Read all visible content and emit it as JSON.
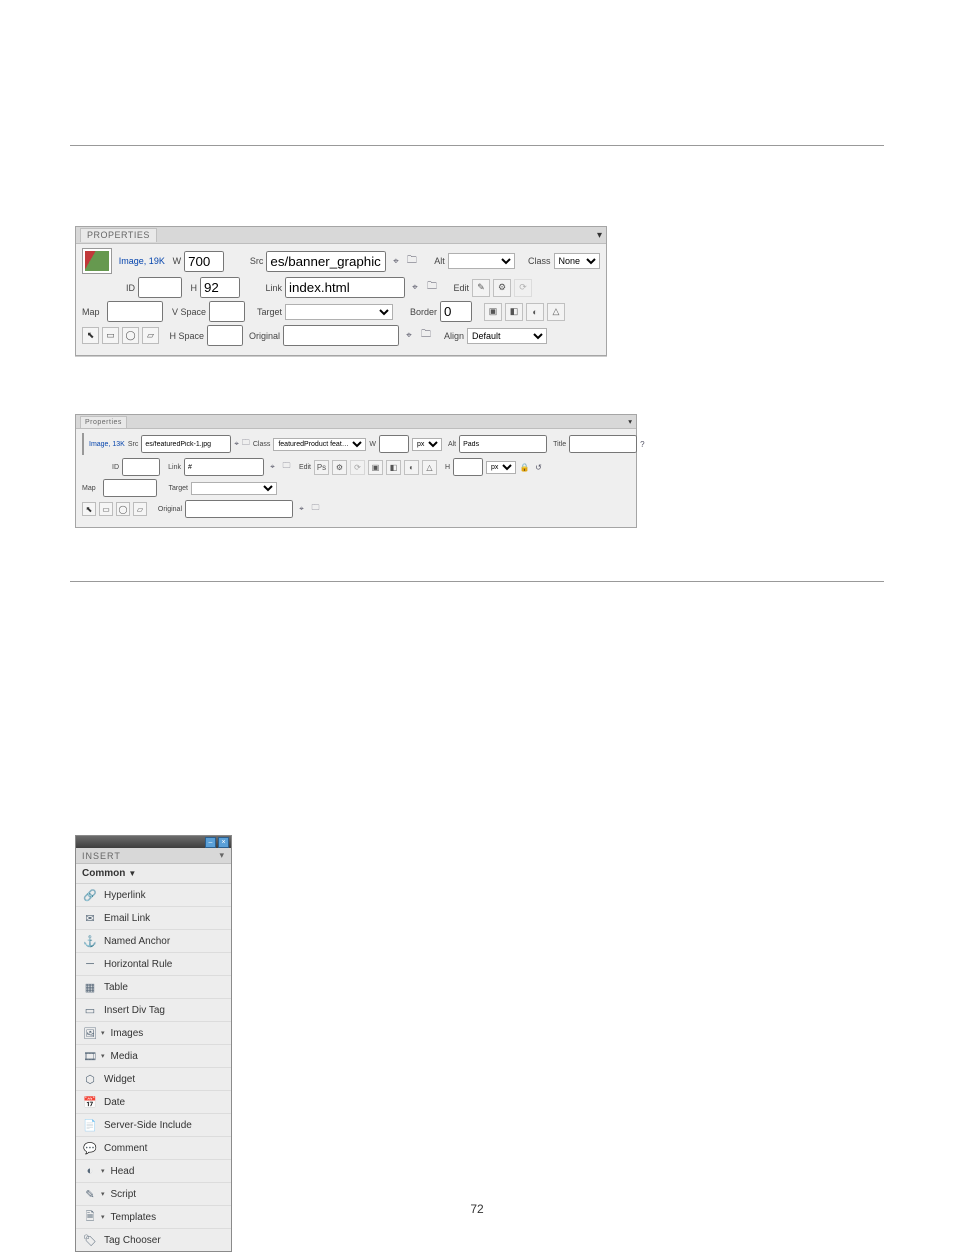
{
  "page_number": "72",
  "properties1": {
    "tab_label": "PROPERTIES",
    "image_label": "Image, 19K",
    "id_label": "ID",
    "id_value": "",
    "w_label": "W",
    "w_value": "700",
    "h_label": "H",
    "h_value": "92",
    "src_label": "Src",
    "src_value": "es/banner_graphic.jpg",
    "link_label": "Link",
    "link_value": "index.html",
    "alt_label": "Alt",
    "alt_value": "",
    "class_label": "Class",
    "class_value": "None",
    "edit_label": "Edit",
    "map_label": "Map",
    "map_value": "",
    "vspace_label": "V Space",
    "vspace_value": "",
    "hspace_label": "H Space",
    "hspace_value": "",
    "target_label": "Target",
    "target_value": "",
    "original_label": "Original",
    "original_value": "",
    "border_label": "Border",
    "border_value": "0",
    "align_label": "Align",
    "align_value": "Default"
  },
  "properties2": {
    "tab_label": "Properties",
    "image_label": "Image, 13K",
    "id_label": "ID",
    "id_value": "",
    "src_label": "Src",
    "src_value": "es/featuredPick-1.jpg",
    "link_label": "Link",
    "link_value": "#",
    "class_label": "Class",
    "class_value": "featuredProduct feat…",
    "alt_label": "Alt",
    "alt_value": "Pads",
    "title_label": "Title",
    "title_value": "",
    "edit_label": "Edit",
    "w_label": "W",
    "h_label": "H",
    "px_label": "px",
    "map_label": "Map",
    "map_value": "",
    "target_label": "Target",
    "target_value": "",
    "original_label": "Original",
    "original_value": ""
  },
  "insert": {
    "tab_label": "INSERT",
    "category": "Common",
    "items": [
      {
        "icon": "🔗",
        "label": "Hyperlink",
        "has_sub": false
      },
      {
        "icon": "✉",
        "label": "Email Link",
        "has_sub": false
      },
      {
        "icon": "⚓",
        "label": "Named Anchor",
        "has_sub": false
      },
      {
        "icon": "─",
        "label": "Horizontal Rule",
        "has_sub": false
      },
      {
        "icon": "▦",
        "label": "Table",
        "has_sub": false
      },
      {
        "icon": "▭",
        "label": "Insert Div Tag",
        "has_sub": false
      },
      {
        "icon": "🖼",
        "label": "Images",
        "has_sub": true
      },
      {
        "icon": "🎞",
        "label": "Media",
        "has_sub": true
      },
      {
        "icon": "⬡",
        "label": "Widget",
        "has_sub": false
      },
      {
        "icon": "📅",
        "label": "Date",
        "has_sub": false
      },
      {
        "icon": "📄",
        "label": "Server-Side Include",
        "has_sub": false
      },
      {
        "icon": "💬",
        "label": "Comment",
        "has_sub": false
      },
      {
        "icon": "◐",
        "label": "Head",
        "has_sub": true
      },
      {
        "icon": "✎",
        "label": "Script",
        "has_sub": true
      },
      {
        "icon": "🗎",
        "label": "Templates",
        "has_sub": true
      },
      {
        "icon": "🏷",
        "label": "Tag Chooser",
        "has_sub": false
      }
    ]
  }
}
